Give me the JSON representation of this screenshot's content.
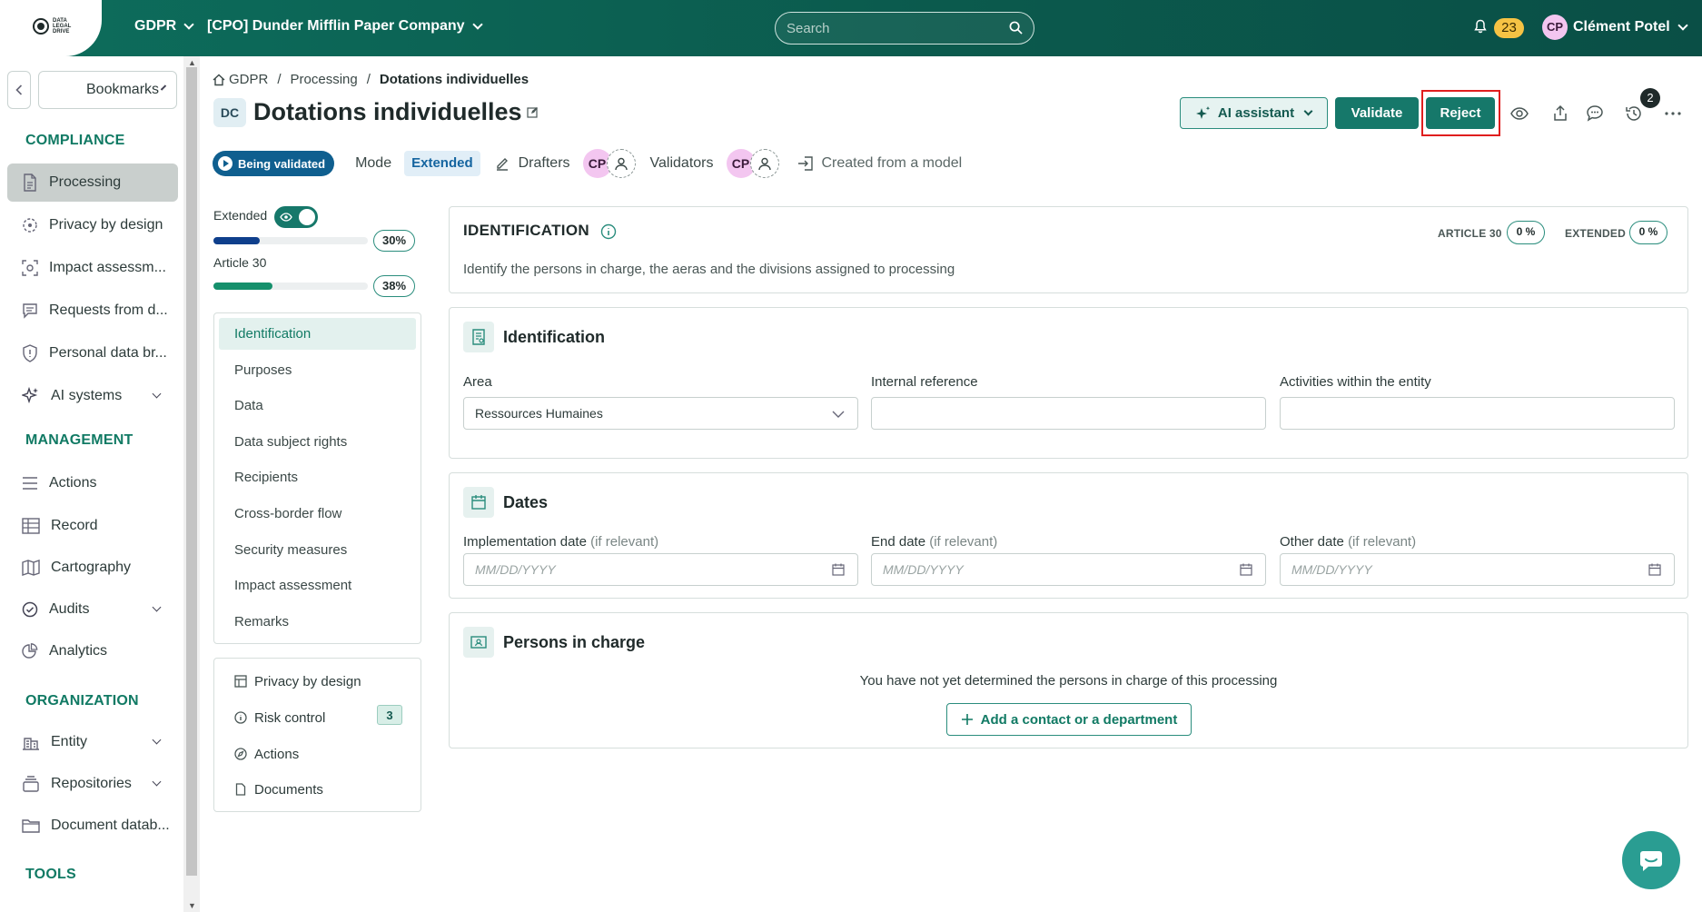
{
  "topbar": {
    "logo_text": "DATA LEGAL DRIVE",
    "module": "GDPR",
    "company": "[CPO] Dunder Mifflin Paper Company",
    "search_placeholder": "Search",
    "notif_count": "23",
    "user_initials": "CP",
    "user_name": "Clément Potel"
  },
  "sidebar": {
    "bookmarks_label": "Bookmarks",
    "compliance_title": "COMPLIANCE",
    "compliance_items": [
      {
        "label": "Processing",
        "icon": "document-icon"
      },
      {
        "label": "Privacy by design",
        "icon": "target-icon"
      },
      {
        "label": "Impact assessm...",
        "icon": "focus-icon"
      },
      {
        "label": "Requests from d...",
        "icon": "chat-icon"
      },
      {
        "label": "Personal data br...",
        "icon": "shield-icon"
      },
      {
        "label": "AI systems",
        "icon": "sparkle-icon"
      }
    ],
    "management_title": "MANAGEMENT",
    "management_items": [
      {
        "label": "Actions",
        "icon": "list-icon"
      },
      {
        "label": "Record",
        "icon": "table-icon"
      },
      {
        "label": "Cartography",
        "icon": "map-icon"
      },
      {
        "label": "Audits",
        "icon": "check-circle-icon"
      },
      {
        "label": "Analytics",
        "icon": "pie-icon"
      }
    ],
    "organization_title": "ORGANIZATION",
    "organization_items": [
      {
        "label": "Entity",
        "icon": "building-icon"
      },
      {
        "label": "Repositories",
        "icon": "stack-icon"
      },
      {
        "label": "Document datab...",
        "icon": "folder-icon"
      }
    ],
    "tools_title": "TOOLS"
  },
  "breadcrumb": {
    "home": "GDPR",
    "section": "Processing",
    "current": "Dotations individuelles"
  },
  "header": {
    "badge": "DC",
    "title": "Dotations individuelles",
    "ai_label": "AI assistant",
    "validate_label": "Validate",
    "reject_label": "Reject",
    "history_count": "2"
  },
  "meta": {
    "status": "Being validated",
    "mode_label": "Mode",
    "mode_value": "Extended",
    "drafters_label": "Drafters",
    "drafter_initials": "CP",
    "validators_label": "Validators",
    "validator_initials": "CP",
    "created_from": "Created from a model"
  },
  "progress": {
    "extended_label": "Extended",
    "extended_pct": "30%",
    "extended_value": 0.3,
    "extended_color": "#0f3f8c",
    "article30_label": "Article 30",
    "article30_pct": "38%",
    "article30_value": 0.38,
    "article30_color": "#15906c"
  },
  "toc": [
    "Identification",
    "Purposes",
    "Data",
    "Data subject rights",
    "Recipients",
    "Cross-border flow",
    "Security measures",
    "Impact assessment",
    "Remarks"
  ],
  "links": {
    "privacy_by_design": "Privacy by design",
    "risk_control": "Risk control",
    "risk_count": "3",
    "actions": "Actions",
    "documents": "Documents"
  },
  "identification_card": {
    "title": "IDENTIFICATION",
    "description": "Identify the persons in charge, the aeras and the divisions assigned to processing",
    "article30_label": "ARTICLE 30",
    "article30_value": "0 %",
    "extended_label": "EXTENDED",
    "extended_value": "0 %"
  },
  "identification_section": {
    "title": "Identification",
    "area_label": "Area",
    "area_value": "Ressources Humaines",
    "internal_ref_label": "Internal reference",
    "internal_ref_value": "",
    "activities_label": "Activities within the entity",
    "activities_value": ""
  },
  "dates_section": {
    "title": "Dates",
    "impl_label": "Implementation date",
    "end_label": "End date",
    "other_label": "Other date",
    "optional": "(if relevant)",
    "date_placeholder": "MM/DD/YYYY"
  },
  "persons_section": {
    "title": "Persons in charge",
    "empty_text": "You have not yet determined the persons in charge of this processing",
    "add_label": "Add a contact or a department"
  }
}
